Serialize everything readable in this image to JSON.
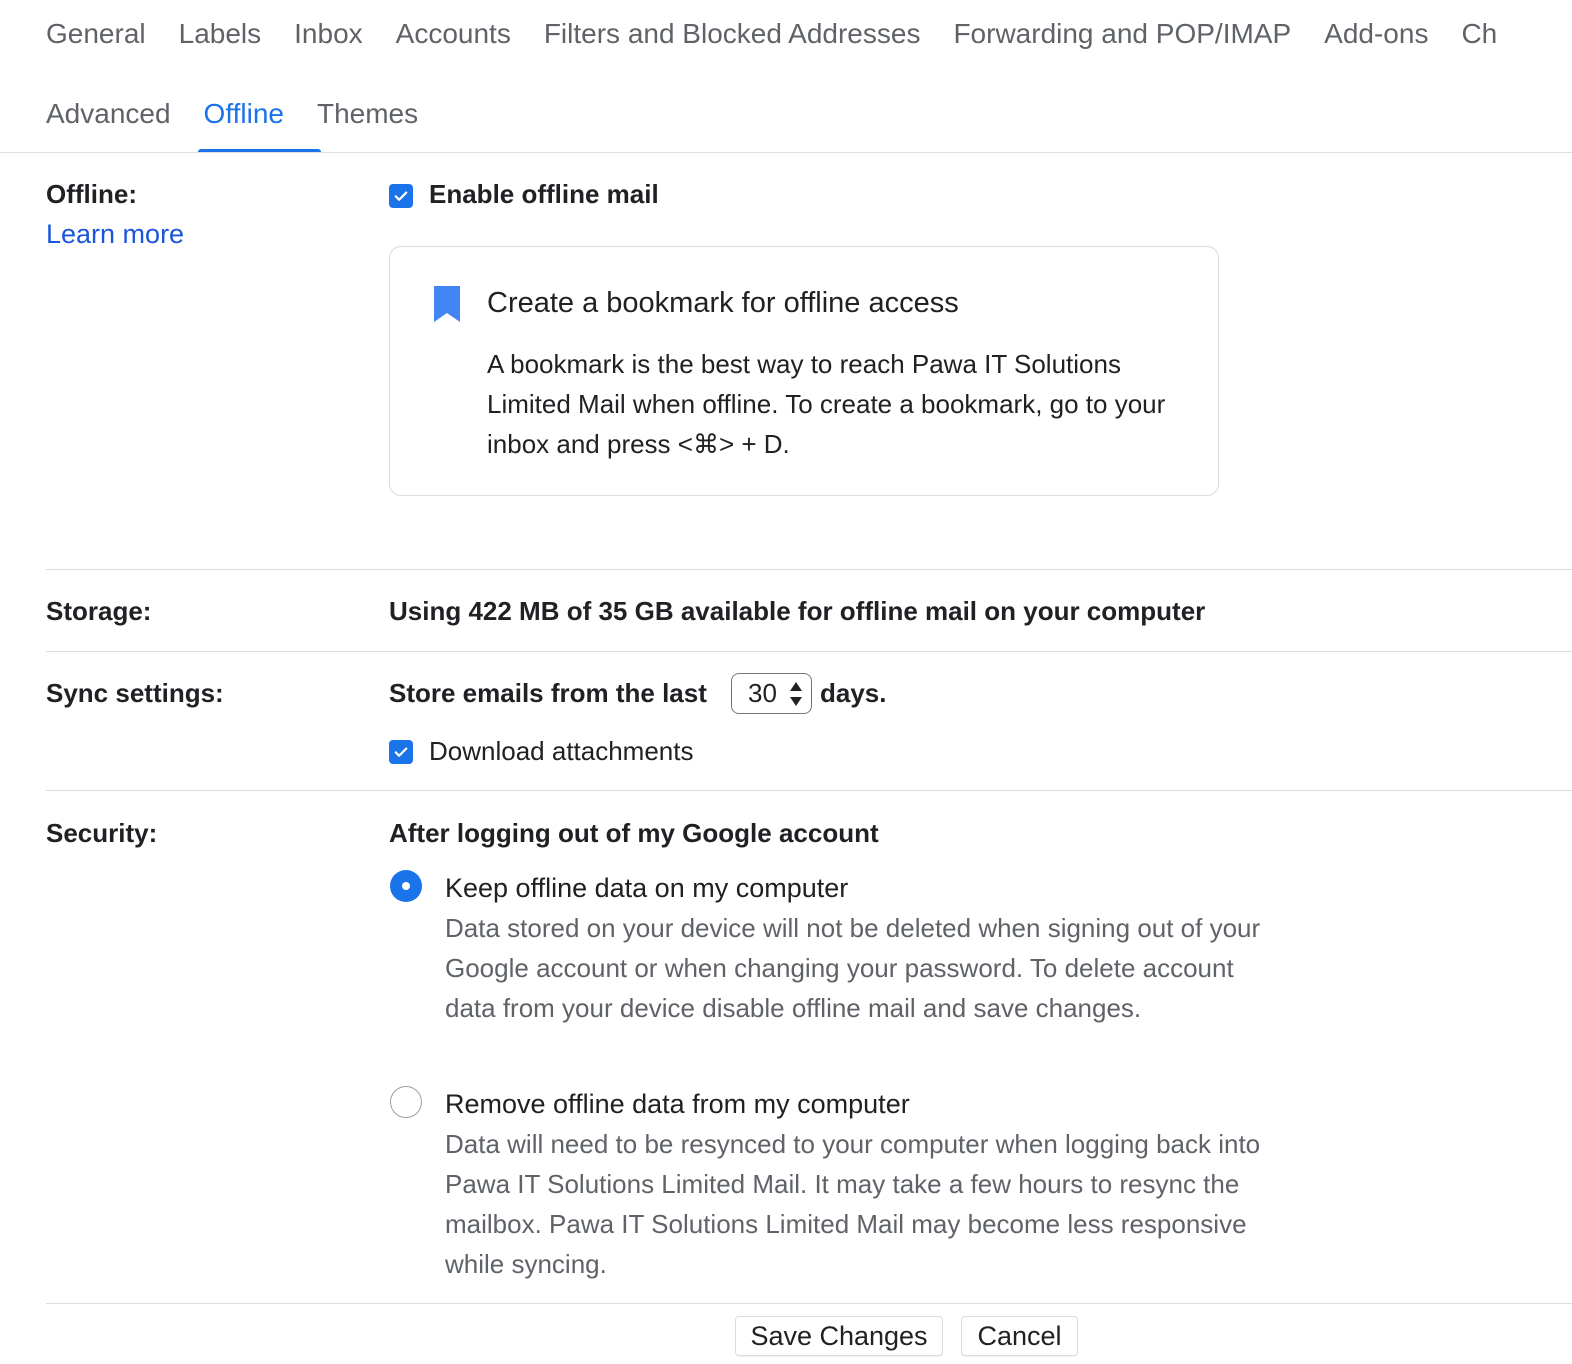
{
  "tabs_row1": [
    "General",
    "Labels",
    "Inbox",
    "Accounts",
    "Filters and Blocked Addresses",
    "Forwarding and POP/IMAP",
    "Add-ons",
    "Ch"
  ],
  "tabs_row2": [
    "Advanced",
    "Offline",
    "Themes"
  ],
  "active_tab": "Offline",
  "offline": {
    "label": "Offline:",
    "learn_more": "Learn more",
    "enable_label": "Enable offline mail",
    "enable_checked": true,
    "card": {
      "title": "Create a bookmark for offline access",
      "body": "A bookmark is the best way to reach Pawa IT Solutions Limited Mail when offline. To create a bookmark, go to your inbox and press <⌘> + D."
    }
  },
  "storage": {
    "label": "Storage:",
    "text": "Using 422 MB of 35 GB available for offline mail on your computer"
  },
  "sync": {
    "label": "Sync settings:",
    "prefix": "Store emails from the last",
    "days_value": "30",
    "suffix": "days.",
    "download_label": "Download attachments",
    "download_checked": true
  },
  "security": {
    "label": "Security:",
    "heading": "After logging out of my Google account",
    "selected": "keep",
    "options": [
      {
        "title": "Keep offline data on my computer",
        "desc": "Data stored on your device will not be deleted when signing out of your Google account or when changing your password. To delete account data from your device disable offline mail and save changes."
      },
      {
        "title": "Remove offline data from my computer",
        "desc": "Data will need to be resynced to your computer when logging back into Pawa IT Solutions Limited Mail. It may take a few hours to resync the mailbox. Pawa IT Solutions Limited Mail may become less responsive while syncing."
      }
    ]
  },
  "buttons": {
    "save": "Save Changes",
    "cancel": "Cancel"
  },
  "colors": {
    "accent": "#1a73e8",
    "link": "#1a56db",
    "muted_text": "#5f6368"
  }
}
